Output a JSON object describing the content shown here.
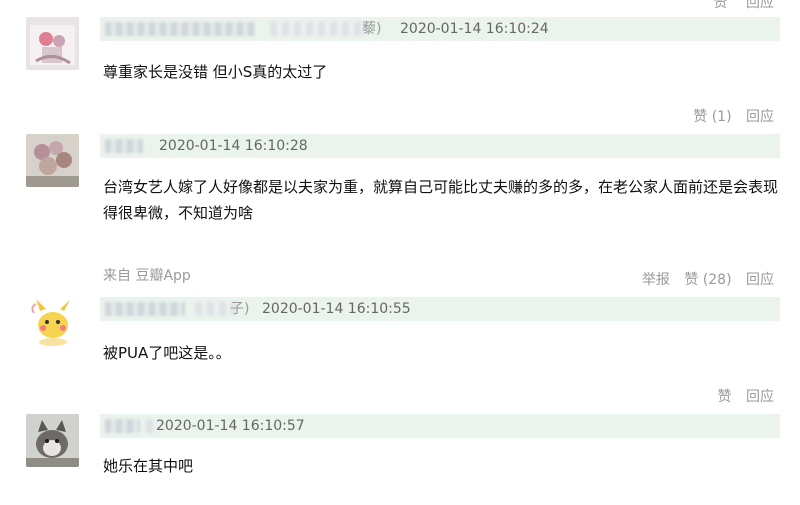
{
  "top_actions": {
    "like": "赞",
    "reply": "回应"
  },
  "comments": [
    {
      "user_suffix": "藜)",
      "time": "2020-01-14 16:10:24",
      "text": "尊重家长是没错 但小S真的太过了",
      "like": "赞 (1)",
      "reply": "回应"
    },
    {
      "user_suffix": "",
      "time": "2020-01-14 16:10:28",
      "text": "台湾女艺人嫁了人好像都是以夫家为重，就算自己可能比丈夫赚的多的多，在老公家人面前还是会表现得很卑微，不知道为啥",
      "source": "来自 豆瓣App",
      "report": "举报",
      "like": "赞 (28)",
      "reply": "回应"
    },
    {
      "user_suffix": "子)",
      "time": "2020-01-14 16:10:55",
      "text": "被PUA了吧这是。。",
      "like": "赞",
      "reply": "回应"
    },
    {
      "user_suffix": "",
      "time": "2020-01-14 16:10:57",
      "text": "她乐在其中吧"
    }
  ]
}
